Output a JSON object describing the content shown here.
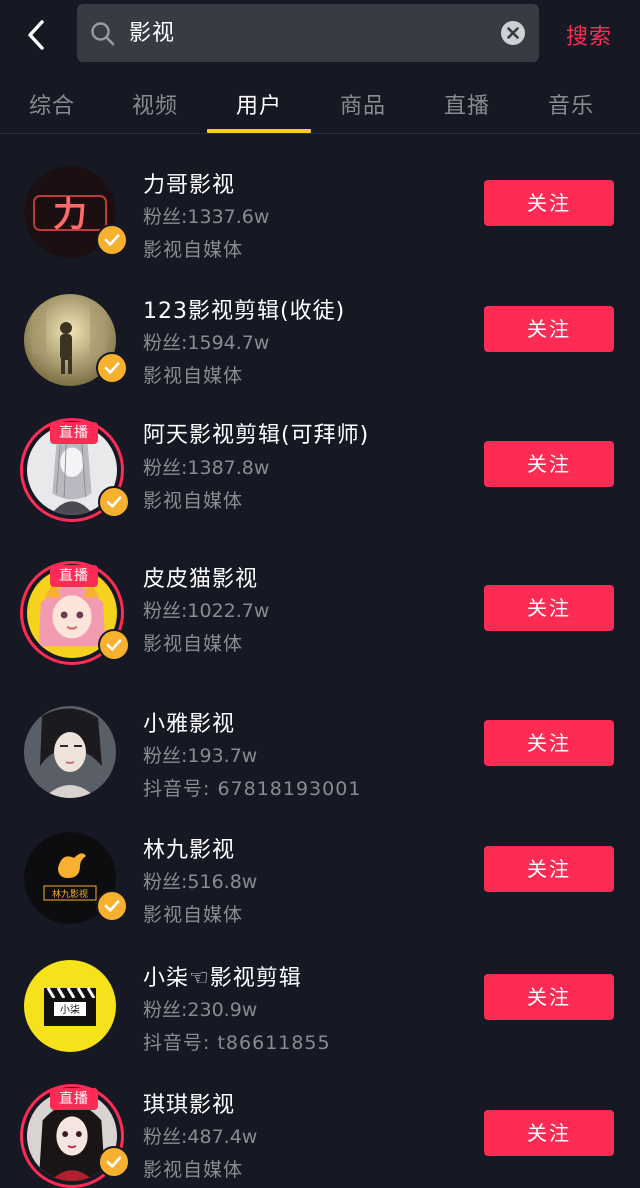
{
  "search": {
    "query": "影视",
    "button_label": "搜索"
  },
  "tabs": [
    {
      "label": "综合"
    },
    {
      "label": "视频"
    },
    {
      "label": "用户"
    },
    {
      "label": "商品"
    },
    {
      "label": "直播"
    },
    {
      "label": "音乐"
    }
  ],
  "active_tab": "用户",
  "colors": {
    "background": "#161823",
    "accent": "#fe2c55",
    "tab_indicator": "#face15",
    "verify_badge": "#f7b12e",
    "muted_text": "#8a8b91"
  },
  "live_badge_label": "直播",
  "users": [
    {
      "name": "力哥影视",
      "fans": "粉丝:1337.6w",
      "desc": "影视自媒体",
      "follow_label": "关注",
      "live": false,
      "verified": true,
      "avatar_icon": "neon-li-logo",
      "avatar_text": "力"
    },
    {
      "name": "123影视剪辑(收徒)",
      "fans": "粉丝:1594.7w",
      "desc": "影视自媒体",
      "follow_label": "关注",
      "live": false,
      "verified": true,
      "avatar_icon": "silhouette-photo"
    },
    {
      "name": "阿天影视剪辑(可拜师)",
      "fans": "粉丝:1387.8w",
      "desc": "影视自媒体",
      "follow_label": "关注",
      "live": true,
      "verified": true,
      "avatar_icon": "sketch-portrait"
    },
    {
      "name": "皮皮猫影视",
      "fans": "粉丝:1022.7w",
      "desc": "影视自媒体",
      "follow_label": "关注",
      "live": true,
      "verified": true,
      "avatar_icon": "anime-girl-yellow"
    },
    {
      "name": "小雅影视",
      "fans": "粉丝:193.7w",
      "desc": "抖音号: 67818193001",
      "follow_label": "关注",
      "live": false,
      "verified": false,
      "avatar_icon": "portrait-photo"
    },
    {
      "name": "林九影视",
      "fans": "粉丝:516.8w",
      "desc": "影视自媒体",
      "follow_label": "关注",
      "live": false,
      "verified": true,
      "avatar_icon": "bird-logo",
      "avatar_text": "林九影视"
    },
    {
      "name": "小柒☜影视剪辑",
      "fans": "粉丝:230.9w",
      "desc": "抖音号: t86611855",
      "follow_label": "关注",
      "live": false,
      "verified": false,
      "avatar_icon": "clapperboard-logo",
      "avatar_text": "小柒"
    },
    {
      "name": "琪琪影视",
      "fans": "粉丝:487.4w",
      "desc": "影视自媒体",
      "follow_label": "关注",
      "live": true,
      "verified": true,
      "avatar_icon": "anime-girl-red"
    }
  ]
}
